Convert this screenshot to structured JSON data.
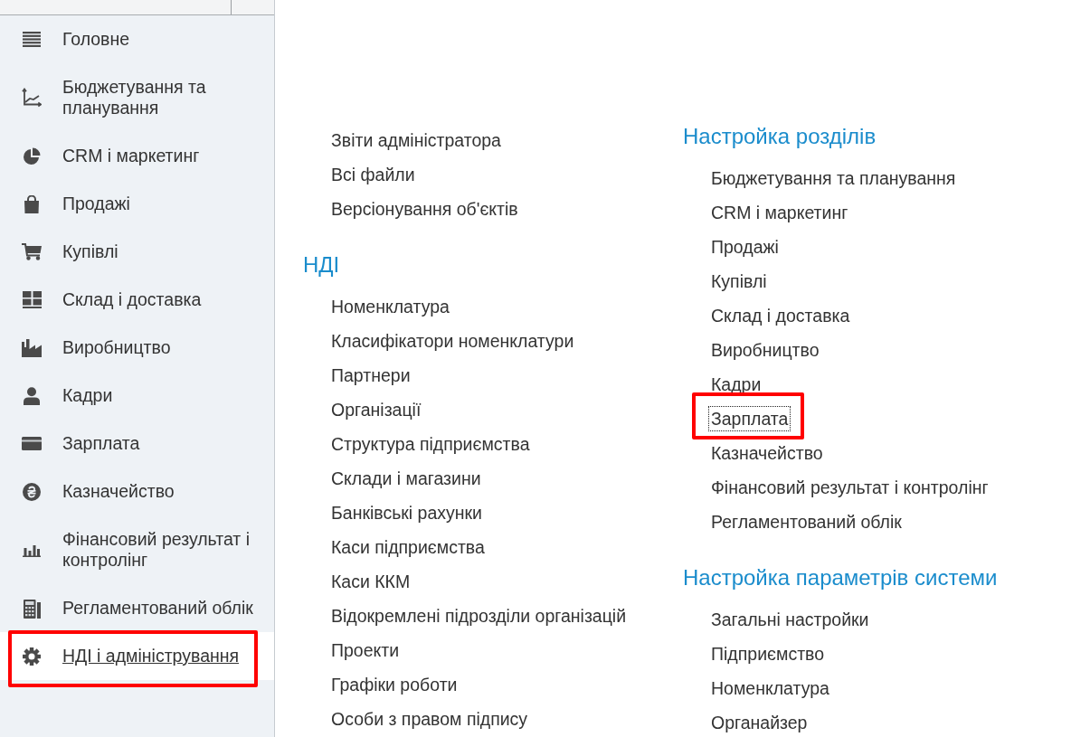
{
  "sidebar": {
    "items": [
      {
        "label": "Головне",
        "selected": false,
        "highlighted": false
      },
      {
        "label": "Бюджетування та планування",
        "selected": false,
        "highlighted": false
      },
      {
        "label": "CRM і маркетинг",
        "selected": false,
        "highlighted": false
      },
      {
        "label": "Продажі",
        "selected": false,
        "highlighted": false
      },
      {
        "label": "Купівлі",
        "selected": false,
        "highlighted": false
      },
      {
        "label": "Склад і доставка",
        "selected": false,
        "highlighted": false
      },
      {
        "label": "Виробництво",
        "selected": false,
        "highlighted": false
      },
      {
        "label": "Кадри",
        "selected": false,
        "highlighted": false
      },
      {
        "label": "Зарплата",
        "selected": false,
        "highlighted": false
      },
      {
        "label": "Казначейство",
        "selected": false,
        "highlighted": false
      },
      {
        "label": "Фінансовий результат і контролінг",
        "selected": false,
        "highlighted": false
      },
      {
        "label": "Регламентований облік",
        "selected": false,
        "highlighted": false
      },
      {
        "label": "НДІ і адміністрування",
        "selected": true,
        "highlighted": true
      }
    ]
  },
  "main": {
    "columns": [
      {
        "groups": [
          {
            "items": [
              {
                "label": "Звіти адміністратора",
                "focused": false,
                "highlighted": false
              },
              {
                "label": "Всі файли",
                "focused": false,
                "highlighted": false
              },
              {
                "label": "Версіонування об'єктів",
                "focused": false,
                "highlighted": false
              }
            ]
          },
          {
            "heading": "НДІ",
            "items": [
              {
                "label": "Номенклатура",
                "focused": false,
                "highlighted": false
              },
              {
                "label": "Класифікатори номенклатури",
                "focused": false,
                "highlighted": false
              },
              {
                "label": "Партнери",
                "focused": false,
                "highlighted": false
              },
              {
                "label": "Організації",
                "focused": false,
                "highlighted": false
              },
              {
                "label": "Структура підприємства",
                "focused": false,
                "highlighted": false
              },
              {
                "label": "Склади і магазини",
                "focused": false,
                "highlighted": false
              },
              {
                "label": "Банківські рахунки",
                "focused": false,
                "highlighted": false
              },
              {
                "label": "Каси підприємства",
                "focused": false,
                "highlighted": false
              },
              {
                "label": "Каси ККМ",
                "focused": false,
                "highlighted": false
              },
              {
                "label": "Відокремлені підрозділи організацій",
                "focused": false,
                "highlighted": false
              },
              {
                "label": "Проекти",
                "focused": false,
                "highlighted": false
              },
              {
                "label": "Графіки роботи",
                "focused": false,
                "highlighted": false
              },
              {
                "label": "Особи з правом підпису",
                "focused": false,
                "highlighted": false
              }
            ]
          }
        ]
      },
      {
        "groups": [
          {
            "heading": "Настройка розділів",
            "items": [
              {
                "label": "Бюджетування та планування",
                "focused": false,
                "highlighted": false
              },
              {
                "label": "CRM і маркетинг",
                "focused": false,
                "highlighted": false
              },
              {
                "label": "Продажі",
                "focused": false,
                "highlighted": false
              },
              {
                "label": "Купівлі",
                "focused": false,
                "highlighted": false
              },
              {
                "label": "Склад і доставка",
                "focused": false,
                "highlighted": false
              },
              {
                "label": "Виробництво",
                "focused": false,
                "highlighted": false
              },
              {
                "label": "Кадри",
                "focused": false,
                "highlighted": false
              },
              {
                "label": "Зарплата",
                "focused": true,
                "highlighted": true
              },
              {
                "label": "Казначейство",
                "focused": false,
                "highlighted": false
              },
              {
                "label": "Фінансовий результат і контролінг",
                "focused": false,
                "highlighted": false
              },
              {
                "label": "Регламентований облік",
                "focused": false,
                "highlighted": false
              }
            ]
          },
          {
            "heading": "Настройка параметрів системи",
            "items": [
              {
                "label": "Загальні настройки",
                "focused": false,
                "highlighted": false
              },
              {
                "label": "Підприємство",
                "focused": false,
                "highlighted": false
              },
              {
                "label": "Номенклатура",
                "focused": false,
                "highlighted": false
              },
              {
                "label": "Органайзер",
                "focused": false,
                "highlighted": false
              }
            ]
          }
        ]
      }
    ]
  }
}
